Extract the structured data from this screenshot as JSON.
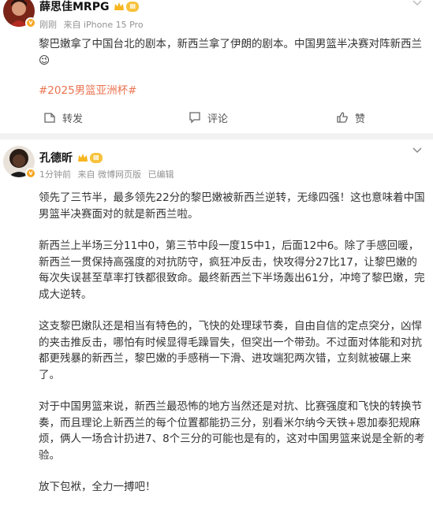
{
  "colors": {
    "hashtag": "#eb7350",
    "meta": "#939393",
    "badge": "#f7c23c",
    "verify": "#f5a623"
  },
  "posts": [
    {
      "author": "薛思佳MRPG",
      "level_badge": "Ⅲ",
      "meta": {
        "time": "刚刚",
        "source": "来自 iPhone 15 Pro"
      },
      "paragraphs": [
        "黎巴嫩拿了中国台北的剧本，新西兰拿了伊朗的剧本。中国男篮半决赛对阵新西兰😉"
      ],
      "hashtag": "#2025男篮亚洲杯#",
      "actions": {
        "repost": "转发",
        "comment": "评论",
        "like": "赞"
      }
    },
    {
      "author": "孔德昕",
      "level_badge": "Ⅲ",
      "meta": {
        "time": "1分钟前",
        "source": "来自 微博网页版",
        "edited": "已编辑"
      },
      "paragraphs": [
        "领先了三节半，最多领先22分的黎巴嫩被新西兰逆转，无缘四强！这也意味着中国男篮半决赛面对的就是新西兰啦。",
        "新西兰上半场三分11中0，第三节中段一度15中1，后面12中6。除了手感回暖，新西兰一贯保持高强度的对抗防守，疯狂冲反击，快攻得分27比17，让黎巴嫩的每次失误甚至草率打铁都很致命。最终新西兰下半场轰出61分，冲垮了黎巴嫩，完成大逆转。",
        "这支黎巴嫩队还是相当有特色的，飞快的处理球节奏，自由自信的定点突分，凶悍的夹击推反击，哪怕有时候显得毛躁冒失，但突出一个带劲。不过面对体能和对抗都更残暴的新西兰，黎巴嫩的手感稍一下滑、进攻端犯两次错，立刻就被碾上来了。",
        "对于中国男篮来说，新西兰最恐怖的地方当然还是对抗、比赛强度和飞快的转换节奏，而且理论上新西兰的每个位置都能扔三分，别看米尔纳今天铁+恩加泰犯规麻烦，俩人一场合计扔进7、8个三分的可能也是有的，这对中国男篮来说是全新的考验。",
        "放下包袱，全力一搏吧！"
      ]
    }
  ]
}
